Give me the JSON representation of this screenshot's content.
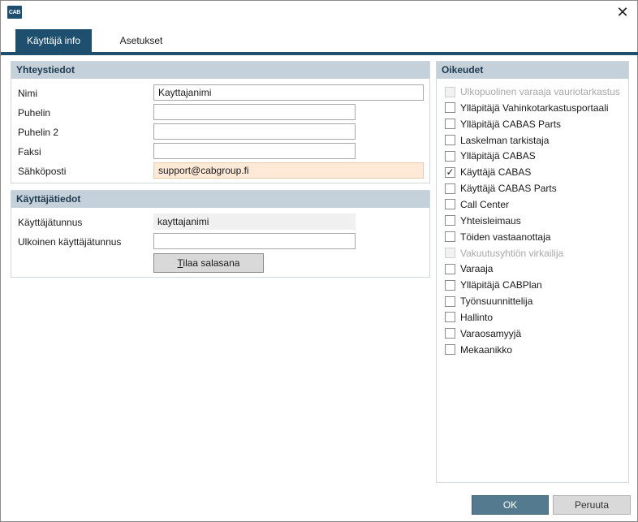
{
  "window": {
    "icon_text": "CAB",
    "close_glyph": "✕"
  },
  "tabs": [
    {
      "label": "Käyttäjä info"
    },
    {
      "label": "Asetukset"
    }
  ],
  "contact": {
    "header": "Yhteystiedot",
    "name_label": "Nimi",
    "name_value": "Kayttajanimi",
    "phone_label": "Puhelin",
    "phone_value": "",
    "phone2_label": "Puhelin 2",
    "phone2_value": "",
    "fax_label": "Faksi",
    "fax_value": "",
    "email_label": "Sähköposti",
    "email_value": "support@cabgroup.fi"
  },
  "user": {
    "header": "Käyttäjätiedot",
    "username_label": "Käyttäjätunnus",
    "username_value": "kayttajanimi",
    "external_label": "Ulkoinen käyttäjätunnus",
    "external_value": "",
    "order_password_mnemonic": "T",
    "order_password_rest": "ilaa salasana"
  },
  "rights": {
    "header": "Oikeudet",
    "items": [
      {
        "label": "Ulkopuolinen varaaja vauriotarkastus",
        "checked": false,
        "disabled": true
      },
      {
        "label": "Ylläpitäjä Vahinkotarkastusportaali",
        "checked": false,
        "disabled": false
      },
      {
        "label": "Ylläpitäjä CABAS Parts",
        "checked": false,
        "disabled": false
      },
      {
        "label": "Laskelman tarkistaja",
        "checked": false,
        "disabled": false
      },
      {
        "label": "Ylläpitäjä CABAS",
        "checked": false,
        "disabled": false
      },
      {
        "label": "Käyttäjä CABAS",
        "checked": true,
        "disabled": false
      },
      {
        "label": "Käyttäjä CABAS Parts",
        "checked": false,
        "disabled": false
      },
      {
        "label": "Call Center",
        "checked": false,
        "disabled": false
      },
      {
        "label": "Yhteisleimaus",
        "checked": false,
        "disabled": false
      },
      {
        "label": "Töiden vastaanottaja",
        "checked": false,
        "disabled": false
      },
      {
        "label": "Vakuutusyhtiön virkailija",
        "checked": false,
        "disabled": true
      },
      {
        "label": "Varaaja",
        "checked": false,
        "disabled": false
      },
      {
        "label": "Ylläpitäjä CABPlan",
        "checked": false,
        "disabled": false
      },
      {
        "label": "Työnsuunnittelija",
        "checked": false,
        "disabled": false
      },
      {
        "label": "Hallinto",
        "checked": false,
        "disabled": false
      },
      {
        "label": "Varaosamyyjä",
        "checked": false,
        "disabled": false
      },
      {
        "label": "Mekaanikko",
        "checked": false,
        "disabled": false
      }
    ]
  },
  "footer": {
    "ok_label": "OK",
    "cancel_label": "Peruuta"
  },
  "colors": {
    "accent": "#1e4f6e",
    "panel_header": "#c5d1da",
    "highlight_field": "#fde9d5",
    "ok_button": "#537a8e"
  }
}
